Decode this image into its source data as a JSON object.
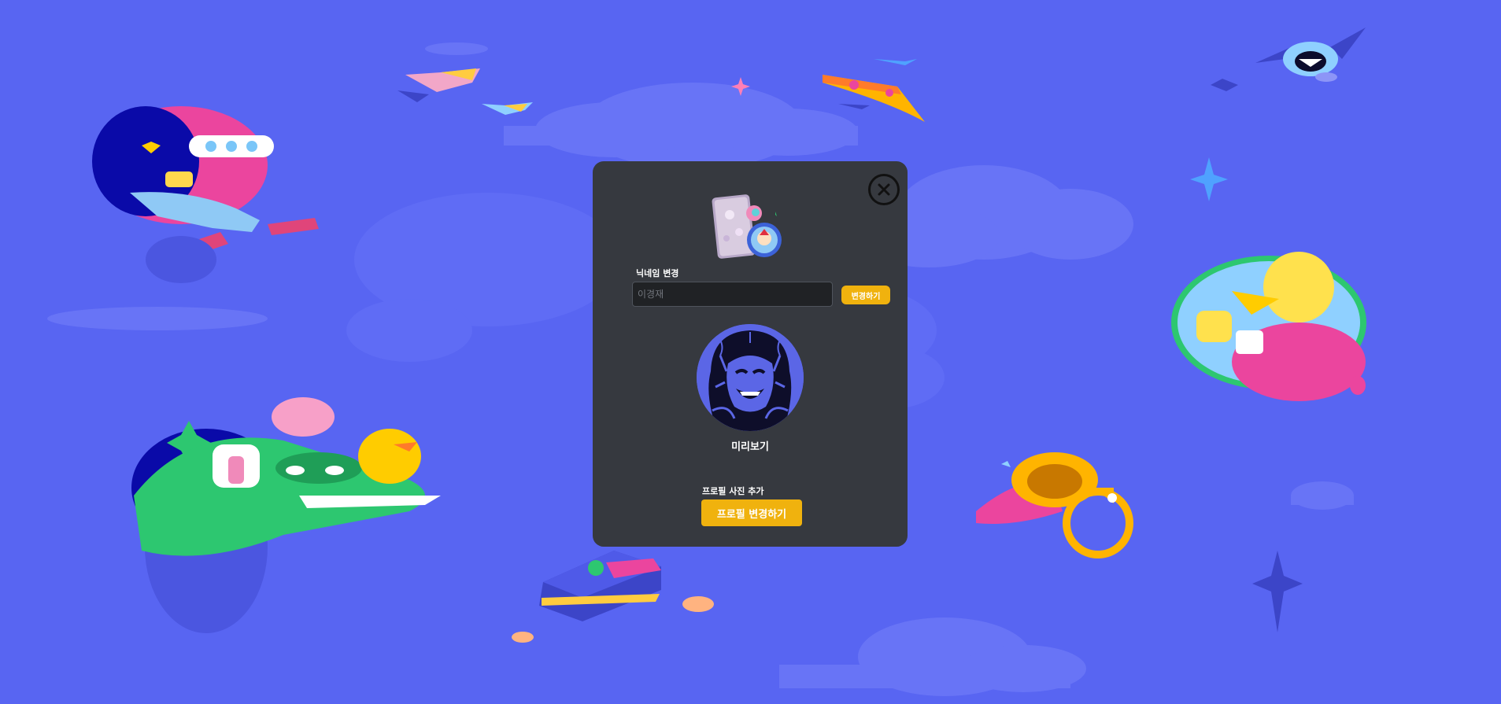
{
  "modal": {
    "nickname": {
      "label": "닉네임 변경",
      "placeholder": "이경재",
      "value": ""
    },
    "change_button": "변경하기",
    "preview_label": "미리보기",
    "add_photo_label": "프로필 사진 추가",
    "profile_change_button": "프로필 변경하기"
  },
  "icons": {
    "close": "close-circle-icon",
    "avatar": "joker-avatar-image",
    "cards": "profile-cards-illustration"
  },
  "colors": {
    "background": "#5865f2",
    "modal": "#36393f",
    "accent": "#f0b20e",
    "input_bg": "#202225"
  }
}
